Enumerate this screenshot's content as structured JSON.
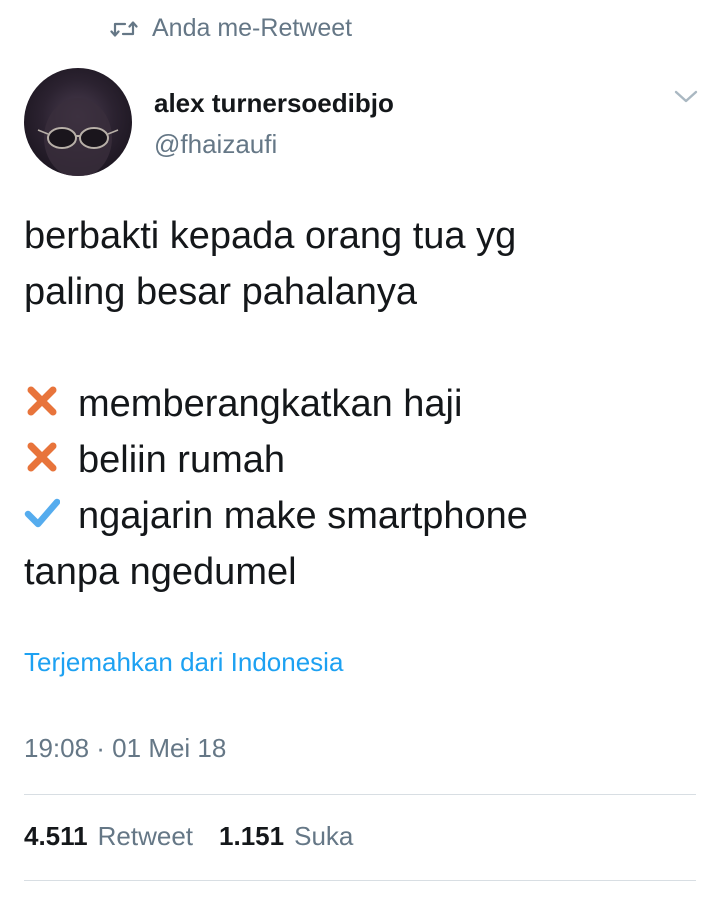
{
  "retweet_header": {
    "icon": "retweet-icon",
    "text": "Anda me-Retweet"
  },
  "author": {
    "name": "alex turnersoedibjo",
    "handle": "@fhaizaufi",
    "avatar": "avatar-photo"
  },
  "menu": {
    "icon": "chevron-down-icon"
  },
  "tweet": {
    "line1": "berbakti kepada orang tua yg",
    "line2": "paling besar pahalanya",
    "items": [
      {
        "icon": "cross-mark-icon",
        "color": "#e8743b",
        "text": "memberangkatkan haji"
      },
      {
        "icon": "cross-mark-icon",
        "color": "#e8743b",
        "text": "beliin rumah"
      },
      {
        "icon": "check-mark-icon",
        "color": "#55acee",
        "text": "ngajarin make smartphone"
      }
    ],
    "line_last": "tanpa ngedumel"
  },
  "translate": "Terjemahkan dari Indonesia",
  "timestamp": "19:08 · 01 Mei 18",
  "stats": {
    "retweets": {
      "count": "4.511",
      "label": "Retweet"
    },
    "likes": {
      "count": "1.151",
      "label": "Suka"
    }
  },
  "colors": {
    "accent": "#1da1f2",
    "secondary_text": "#657786",
    "cross": "#e8743b",
    "check": "#55acee"
  }
}
